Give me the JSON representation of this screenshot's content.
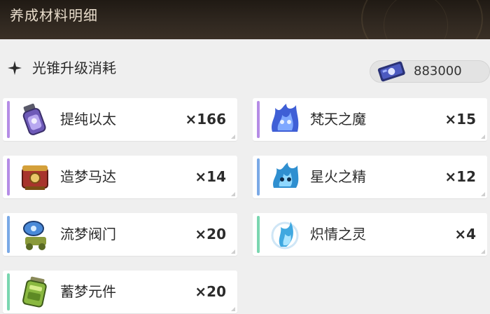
{
  "header": {
    "title": "养成材料明细"
  },
  "section": {
    "title": "光锥升级消耗"
  },
  "credits": {
    "icon": "credit-icon",
    "value": "883000"
  },
  "colors": {
    "purple": "#b58ce6",
    "blue": "#7aa9e6",
    "green": "#7ad6b0"
  },
  "materials": [
    {
      "name": "提纯以太",
      "qty": "×166",
      "icon": "ether-flask-icon",
      "rarity": "purple"
    },
    {
      "name": "梵天之魔",
      "qty": "×15",
      "icon": "blue-flame-demon-icon",
      "rarity": "purple"
    },
    {
      "name": "造梦马达",
      "qty": "×14",
      "icon": "dream-motor-icon",
      "rarity": "purple"
    },
    {
      "name": "星火之精",
      "qty": "×12",
      "icon": "starfire-essence-icon",
      "rarity": "blue"
    },
    {
      "name": "流梦阀门",
      "qty": "×20",
      "icon": "dream-valve-icon",
      "rarity": "blue"
    },
    {
      "name": "炽情之灵",
      "qty": "×4",
      "icon": "passion-spirit-icon",
      "rarity": "green"
    },
    {
      "name": "蓄梦元件",
      "qty": "×20",
      "icon": "dream-battery-icon",
      "rarity": "green"
    }
  ]
}
